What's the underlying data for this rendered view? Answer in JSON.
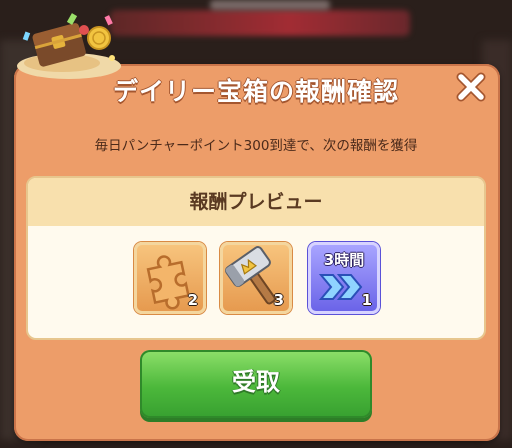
{
  "dialog": {
    "title": "デイリー宝箱の報酬確認",
    "subtitle": "毎日パンチャーポイント300到達で、次の報酬を獲得",
    "close_icon": "close-x-icon"
  },
  "preview": {
    "header": "報酬プレビュー",
    "items": [
      {
        "icon": "puzzle-piece-icon",
        "count": "2",
        "color": "#e69a4f"
      },
      {
        "icon": "crown-hammer-icon",
        "count": "3",
        "color": "#e69a4f"
      },
      {
        "icon": "time-boost-icon",
        "duration": "3時間",
        "count": "1",
        "color": "#6b64e8"
      }
    ]
  },
  "receive_button": {
    "label": "受取"
  },
  "colors": {
    "dialog_bg": "#ed9d69",
    "panel_header_bg": "#f8e0ad",
    "panel_bg": "#fffaee",
    "button_green": "#4cb83b"
  }
}
